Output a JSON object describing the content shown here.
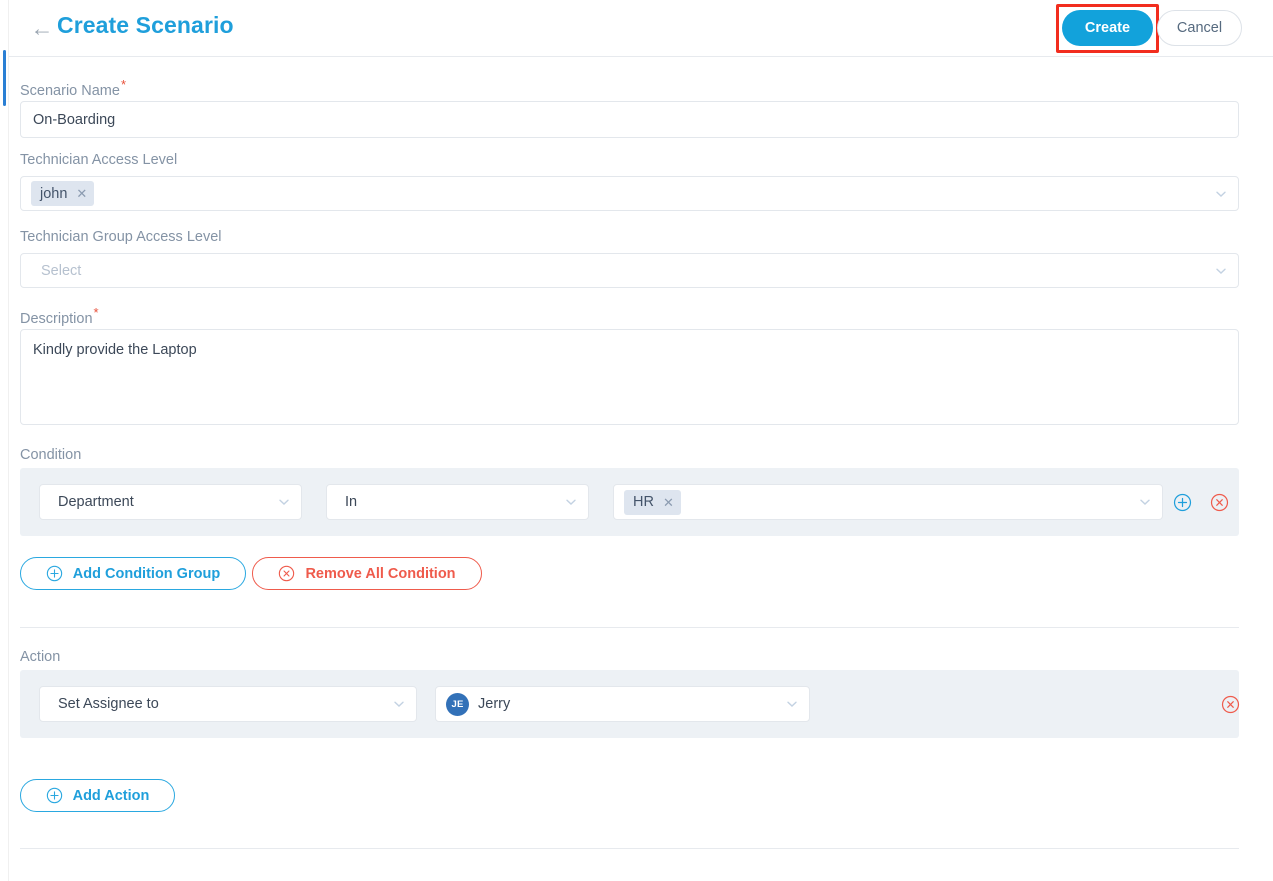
{
  "header": {
    "back_icon": "back-arrow-icon",
    "title": "Create Scenario",
    "create_label": "Create",
    "cancel_label": "Cancel",
    "highlight_color": "#f22d1e",
    "accent_color": "#12a2db"
  },
  "form": {
    "scenario_name": {
      "label": "Scenario Name",
      "required": "*",
      "value": "On-Boarding",
      "placeholder": ""
    },
    "technician_access_level": {
      "label": "Technician Access Level",
      "tags": [
        "john"
      ],
      "placeholder": ""
    },
    "technician_group_access_level": {
      "label": "Technician Group Access Level",
      "value": "",
      "placeholder": "Select"
    },
    "description": {
      "label": "Description",
      "required": "*",
      "value": "Kindly provide the Laptop",
      "placeholder": ""
    }
  },
  "condition": {
    "label": "Condition",
    "rows": [
      {
        "field": "Department",
        "operator": "In",
        "values": [
          "HR"
        ]
      }
    ],
    "add_row_icon": "plus-circle-icon",
    "remove_row_icon": "remove-circle-icon",
    "add_group_label": "Add Condition Group",
    "remove_all_label": "Remove All Condition"
  },
  "action": {
    "label": "Action",
    "rows": [
      {
        "type": "Set Assignee to",
        "assignee_initials": "JE",
        "assignee_name": "Jerry",
        "avatar_color": "#3271b8"
      }
    ],
    "remove_icon": "remove-circle-icon",
    "add_action_label": "Add Action"
  }
}
